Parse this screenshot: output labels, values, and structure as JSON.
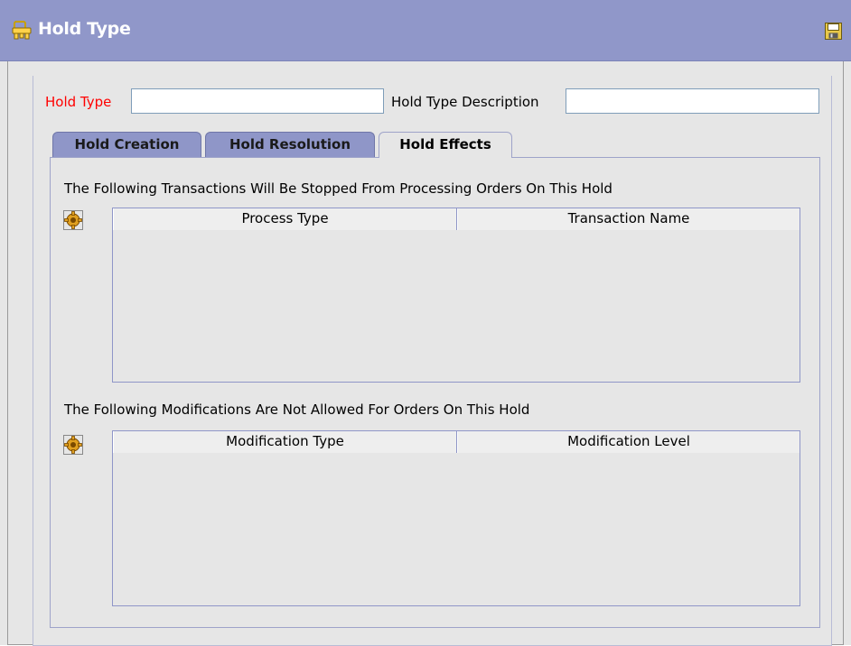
{
  "window": {
    "title": "Hold Type",
    "title_icon": "key-ring-icon",
    "save_icon": "floppy-disk-icon",
    "title_bar_color": "#9097c9"
  },
  "form": {
    "hold_type_label": "Hold Type",
    "hold_type_value": "",
    "hold_type_description_label": "Hold Type Description",
    "hold_type_description_value": ""
  },
  "tabs": [
    {
      "label": "Hold Creation",
      "active": false
    },
    {
      "label": "Hold Resolution",
      "active": false
    },
    {
      "label": "Hold Effects",
      "active": true
    }
  ],
  "transactions_section": {
    "heading": "The Following Transactions Will Be Stopped From Processing Orders On This Hold",
    "action_icon": "gear-icon",
    "columns": [
      "Process Type",
      "Transaction Name"
    ],
    "rows": []
  },
  "modifications_section": {
    "heading": "The Following Modifications Are Not Allowed For Orders On This Hold",
    "action_icon": "gear-icon",
    "columns": [
      "Modification Type",
      "Modification Level"
    ],
    "rows": []
  },
  "colors": {
    "required_label": "#ff0000",
    "tab_inactive": "#8f96c8",
    "panel_background": "#e6e6e6"
  }
}
